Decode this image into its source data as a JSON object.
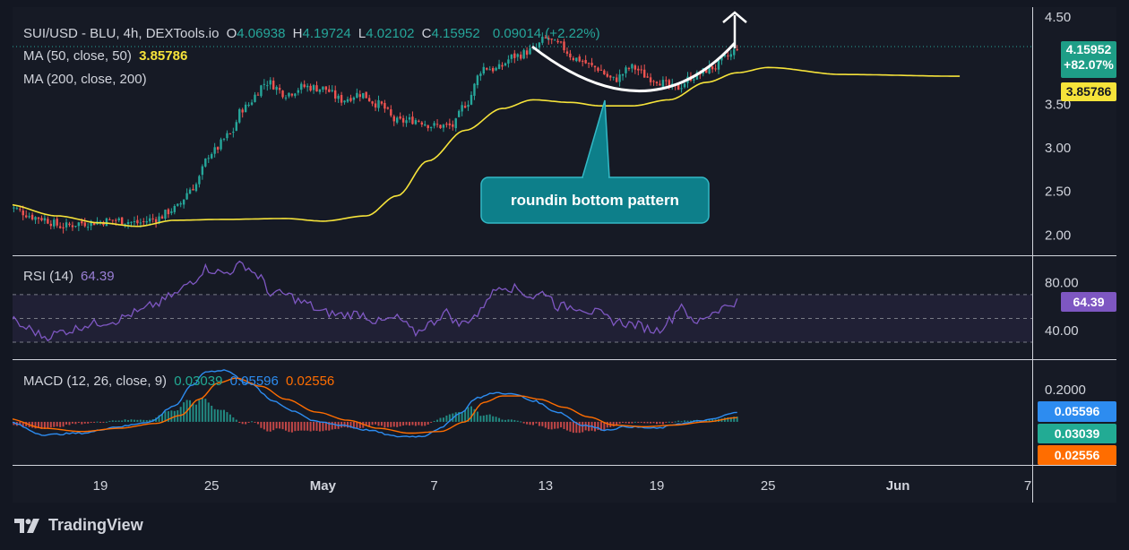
{
  "header": {
    "symbol": "SUI/USD - BLU, 4h, DEXTools.io",
    "o_label": "O",
    "o_value": "4.06938",
    "h_label": "H",
    "h_value": "4.19724",
    "l_label": "L",
    "l_value": "4.02102",
    "c_label": "C",
    "c_value": "4.15952",
    "change": "0.09014 (+2.22%)",
    "ma50_label": "MA (50, close, 50)",
    "ma50_value": "3.85786",
    "ma200_label": "MA (200, close, 200)"
  },
  "badges": {
    "price": "4.15952",
    "price_change": "+82.07%",
    "ma50": "3.85786",
    "rsi": "64.39",
    "macd": "0.05596",
    "macd_hist": "0.03039",
    "signal": "0.02556"
  },
  "rsi_panel": {
    "label": "RSI (14)",
    "value": "64.39"
  },
  "macd_panel": {
    "label": "MACD (12, 26, close, 9)",
    "hist_value": "0.03039",
    "macd_value": "0.05596",
    "signal_value": "0.02556"
  },
  "annotation": {
    "text": "roundin bottom pattern"
  },
  "branding": {
    "name": "TradingView"
  },
  "colors": {
    "up": "#26a69a",
    "down": "#ef5350",
    "ma": "#f6e33a",
    "rsi": "#7e57c2",
    "macd": "#2d8cf0",
    "signal": "#ff6d00",
    "callout": "#0d7f8a"
  },
  "chart_data": {
    "type": "line",
    "x_axis": {
      "ticks": [
        "19",
        "25",
        "May",
        "7",
        "13",
        "19",
        "25",
        "Jun",
        "7"
      ],
      "tick_idx": [
        0,
        36,
        72,
        108,
        144,
        180,
        216,
        258,
        300
      ]
    },
    "price_axis": {
      "ticks": [
        "2.00",
        "2.50",
        "3.00",
        "3.50",
        "4.50"
      ],
      "values": [
        2.0,
        2.5,
        3.0,
        3.5,
        4.5
      ],
      "range": [
        1.82,
        4.57
      ]
    },
    "close_anchors": [
      [
        -30,
        2.32
      ],
      [
        -20,
        2.2
      ],
      [
        -12,
        2.1
      ],
      [
        -6,
        2.14
      ],
      [
        6,
        2.17
      ],
      [
        12,
        2.14
      ],
      [
        18,
        2.19
      ],
      [
        24,
        2.3
      ],
      [
        30,
        2.55
      ],
      [
        36,
        2.95
      ],
      [
        42,
        3.15
      ],
      [
        46,
        3.45
      ],
      [
        54,
        3.75
      ],
      [
        60,
        3.62
      ],
      [
        66,
        3.7
      ],
      [
        72,
        3.68
      ],
      [
        78,
        3.55
      ],
      [
        84,
        3.62
      ],
      [
        90,
        3.5
      ],
      [
        96,
        3.3
      ],
      [
        102,
        3.32
      ],
      [
        108,
        3.25
      ],
      [
        114,
        3.25
      ],
      [
        118,
        3.5
      ],
      [
        124,
        3.92
      ],
      [
        128,
        3.9
      ],
      [
        134,
        4.05
      ],
      [
        140,
        4.12
      ],
      [
        144,
        4.25
      ],
      [
        148,
        4.18
      ],
      [
        154,
        4.02
      ],
      [
        160,
        3.92
      ],
      [
        166,
        3.78
      ],
      [
        172,
        3.92
      ],
      [
        178,
        3.8
      ],
      [
        186,
        3.68
      ],
      [
        192,
        3.82
      ],
      [
        198,
        3.92
      ],
      [
        204,
        4.06
      ],
      [
        206,
        4.16
      ]
    ],
    "ma_anchors": [
      [
        -30,
        2.35
      ],
      [
        -14,
        2.22
      ],
      [
        0,
        2.14
      ],
      [
        12,
        2.1
      ],
      [
        24,
        2.17
      ],
      [
        40,
        2.18
      ],
      [
        60,
        2.19
      ],
      [
        72,
        2.16
      ],
      [
        86,
        2.22
      ],
      [
        96,
        2.45
      ],
      [
        106,
        2.85
      ],
      [
        118,
        3.2
      ],
      [
        130,
        3.45
      ],
      [
        140,
        3.55
      ],
      [
        152,
        3.52
      ],
      [
        162,
        3.48
      ],
      [
        172,
        3.48
      ],
      [
        184,
        3.55
      ],
      [
        196,
        3.75
      ],
      [
        206,
        3.86
      ],
      [
        216,
        3.92
      ],
      [
        240,
        3.84
      ],
      [
        278,
        3.82
      ]
    ],
    "rsi_axis": {
      "ticks": [
        "80.00",
        "40.00"
      ],
      "values": [
        80,
        40
      ],
      "bands": [
        70,
        50,
        30
      ],
      "range": [
        18,
        100
      ]
    },
    "rsi_anchors": [
      [
        -30,
        50
      ],
      [
        -24,
        42
      ],
      [
        -18,
        35
      ],
      [
        -10,
        40
      ],
      [
        -4,
        45
      ],
      [
        4,
        48
      ],
      [
        12,
        55
      ],
      [
        18,
        62
      ],
      [
        24,
        70
      ],
      [
        30,
        82
      ],
      [
        34,
        92
      ],
      [
        40,
        88
      ],
      [
        46,
        95
      ],
      [
        52,
        85
      ],
      [
        54,
        72
      ],
      [
        60,
        70
      ],
      [
        66,
        63
      ],
      [
        72,
        55
      ],
      [
        78,
        53
      ],
      [
        84,
        54
      ],
      [
        90,
        47
      ],
      [
        96,
        50
      ],
      [
        102,
        38
      ],
      [
        106,
        45
      ],
      [
        112,
        55
      ],
      [
        116,
        45
      ],
      [
        122,
        53
      ],
      [
        126,
        70
      ],
      [
        130,
        78
      ],
      [
        134,
        75
      ],
      [
        140,
        68
      ],
      [
        144,
        72
      ],
      [
        148,
        60
      ],
      [
        154,
        60
      ],
      [
        160,
        55
      ],
      [
        166,
        48
      ],
      [
        172,
        45
      ],
      [
        180,
        40
      ],
      [
        184,
        48
      ],
      [
        188,
        62
      ],
      [
        192,
        45
      ],
      [
        196,
        52
      ],
      [
        200,
        58
      ],
      [
        206,
        64
      ]
    ],
    "macd_axis": {
      "ticks": [
        "0.2000"
      ],
      "values": [
        0.2
      ],
      "range": [
        -0.25,
        0.36
      ]
    },
    "macd_anchors": [
      [
        -30,
        0.0
      ],
      [
        -18,
        -0.08
      ],
      [
        -6,
        -0.07
      ],
      [
        6,
        -0.03
      ],
      [
        16,
        0.0
      ],
      [
        24,
        0.1
      ],
      [
        30,
        0.23
      ],
      [
        34,
        0.31
      ],
      [
        40,
        0.32
      ],
      [
        48,
        0.24
      ],
      [
        56,
        0.13
      ],
      [
        62,
        0.07
      ],
      [
        70,
        0.0
      ],
      [
        78,
        -0.02
      ],
      [
        86,
        -0.05
      ],
      [
        96,
        -0.09
      ],
      [
        104,
        -0.09
      ],
      [
        110,
        -0.04
      ],
      [
        116,
        0.05
      ],
      [
        122,
        0.15
      ],
      [
        128,
        0.18
      ],
      [
        134,
        0.17
      ],
      [
        140,
        0.13
      ],
      [
        148,
        0.06
      ],
      [
        156,
        -0.02
      ],
      [
        164,
        -0.05
      ],
      [
        170,
        -0.03
      ],
      [
        180,
        -0.04
      ],
      [
        188,
        -0.01
      ],
      [
        196,
        0.01
      ],
      [
        206,
        0.056
      ]
    ],
    "signal_anchors": [
      [
        -30,
        0.02
      ],
      [
        -18,
        -0.04
      ],
      [
        -6,
        -0.06
      ],
      [
        6,
        -0.04
      ],
      [
        18,
        -0.01
      ],
      [
        26,
        0.04
      ],
      [
        32,
        0.14
      ],
      [
        38,
        0.24
      ],
      [
        44,
        0.27
      ],
      [
        52,
        0.22
      ],
      [
        60,
        0.14
      ],
      [
        70,
        0.06
      ],
      [
        80,
        0.01
      ],
      [
        90,
        -0.04
      ],
      [
        100,
        -0.07
      ],
      [
        110,
        -0.06
      ],
      [
        118,
        0.0
      ],
      [
        124,
        0.12
      ],
      [
        130,
        0.16
      ],
      [
        136,
        0.16
      ],
      [
        142,
        0.14
      ],
      [
        150,
        0.09
      ],
      [
        158,
        0.03
      ],
      [
        166,
        -0.02
      ],
      [
        176,
        -0.03
      ],
      [
        186,
        -0.02
      ],
      [
        196,
        0.0
      ],
      [
        206,
        0.026
      ]
    ]
  }
}
